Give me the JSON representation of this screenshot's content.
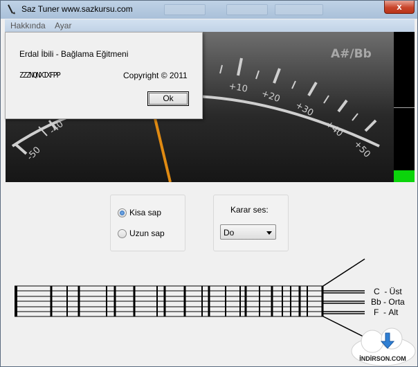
{
  "window": {
    "title": "Saz Tuner www.sazkursu.com",
    "close_glyph": "x"
  },
  "menu": {
    "items": [
      "Hakkında",
      "Ayar"
    ]
  },
  "gauge": {
    "note": "A#/Bb",
    "scale_labels": [
      "-50",
      "-40",
      "+10",
      "+20",
      "+30",
      "+40",
      "+50"
    ],
    "needle_color": "#e08a12"
  },
  "level_meter": {
    "fill_fraction": 0.08,
    "color": "#0bd40b"
  },
  "neck": {
    "options": [
      "Kisa sap",
      "Uzun sap"
    ],
    "selected": "Kisa sap"
  },
  "reference": {
    "label": "Karar ses:",
    "value": "Do"
  },
  "strings": [
    {
      "note": "C",
      "name": "Üst"
    },
    {
      "note": "Bb",
      "name": "Orta"
    },
    {
      "note": "F",
      "name": "Alt"
    }
  ],
  "about_dialog": {
    "line1": "Erdal İbili - Bağlama Eğitmeni",
    "garbled": "ZZZNQNXIXFPP",
    "copyright": "Copyright © 2011",
    "ok_label": "Ok"
  },
  "watermark": {
    "text": "İNDİRSON.COM"
  }
}
